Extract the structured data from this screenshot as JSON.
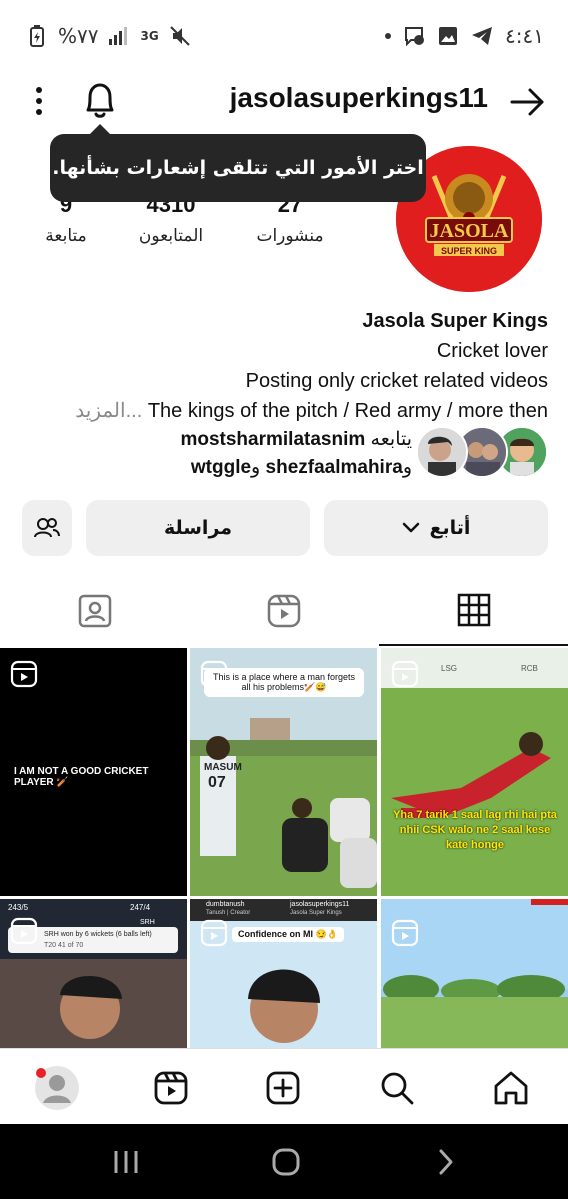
{
  "status_bar": {
    "battery_text": "%٧٧",
    "network": "3G",
    "time": "٤:٤١"
  },
  "header": {
    "username": "jasolasuperkings11"
  },
  "tooltip": {
    "text": "اختر الأمور التي تتلقى إشعارات بشأنها."
  },
  "profile": {
    "logo_main": "JASOLA",
    "logo_sub": "SUPER KING",
    "stats": {
      "posts": {
        "value": "27",
        "label": "منشورات"
      },
      "followers": {
        "value": "4310",
        "label": "المتابعون"
      },
      "following": {
        "value": "9",
        "label": "متابعة"
      }
    },
    "display_name": "Jasola Super Kings",
    "bio_lines": [
      "Cricket lover",
      "Posting only cricket related videos"
    ],
    "bio_truncated": "The kings of the pitch / Red army / more then",
    "more_label": "المزيد",
    "followed_by_prefix": "يتابعه",
    "followed_by_name1": "mostsharmilatasnim",
    "followed_by_and": "و",
    "followed_by_name2": "shezfaalmahira",
    "followed_by_and2": "و",
    "followed_by_name3": "wtggle"
  },
  "actions": {
    "follow_label": "أتابع",
    "message_label": "مراسلة"
  },
  "grid": {
    "cell1_caption": "I AM NOT A GOOD CRICKET PLAYER 🏏",
    "cell2_caption": "This is a place where a man forgets all his problems🏏😅",
    "cell2_jersey_name": "MASUM",
    "cell2_jersey_num": "07",
    "cell3_caption": "Yha 7 tarik 1 saal lag rhi hai pta nhii CSK walo ne 2 saal kese kate honge",
    "cell3_team1": "LSG",
    "cell3_team2": "RCB",
    "cell4_score_left": "243/5",
    "cell4_score_right": "247/4",
    "cell4_result": "SRH won by 6 wickets (6 balls left)",
    "cell4_over": "T20 41 of 70",
    "cell4_team": "SRH",
    "cell5_user1": "dumbtanush",
    "cell5_user1_sub": "Tanush | Creator",
    "cell5_user2": "jasolasuperkings11",
    "cell5_user2_sub": "Jasola Super Kings",
    "cell5_caption": "Confidence on MI 😏👌"
  },
  "colors": {
    "brand_red": "#e01e1e",
    "button_bg": "#efefef",
    "tooltip_bg": "#262626",
    "notification_dot": "#e8202a"
  }
}
